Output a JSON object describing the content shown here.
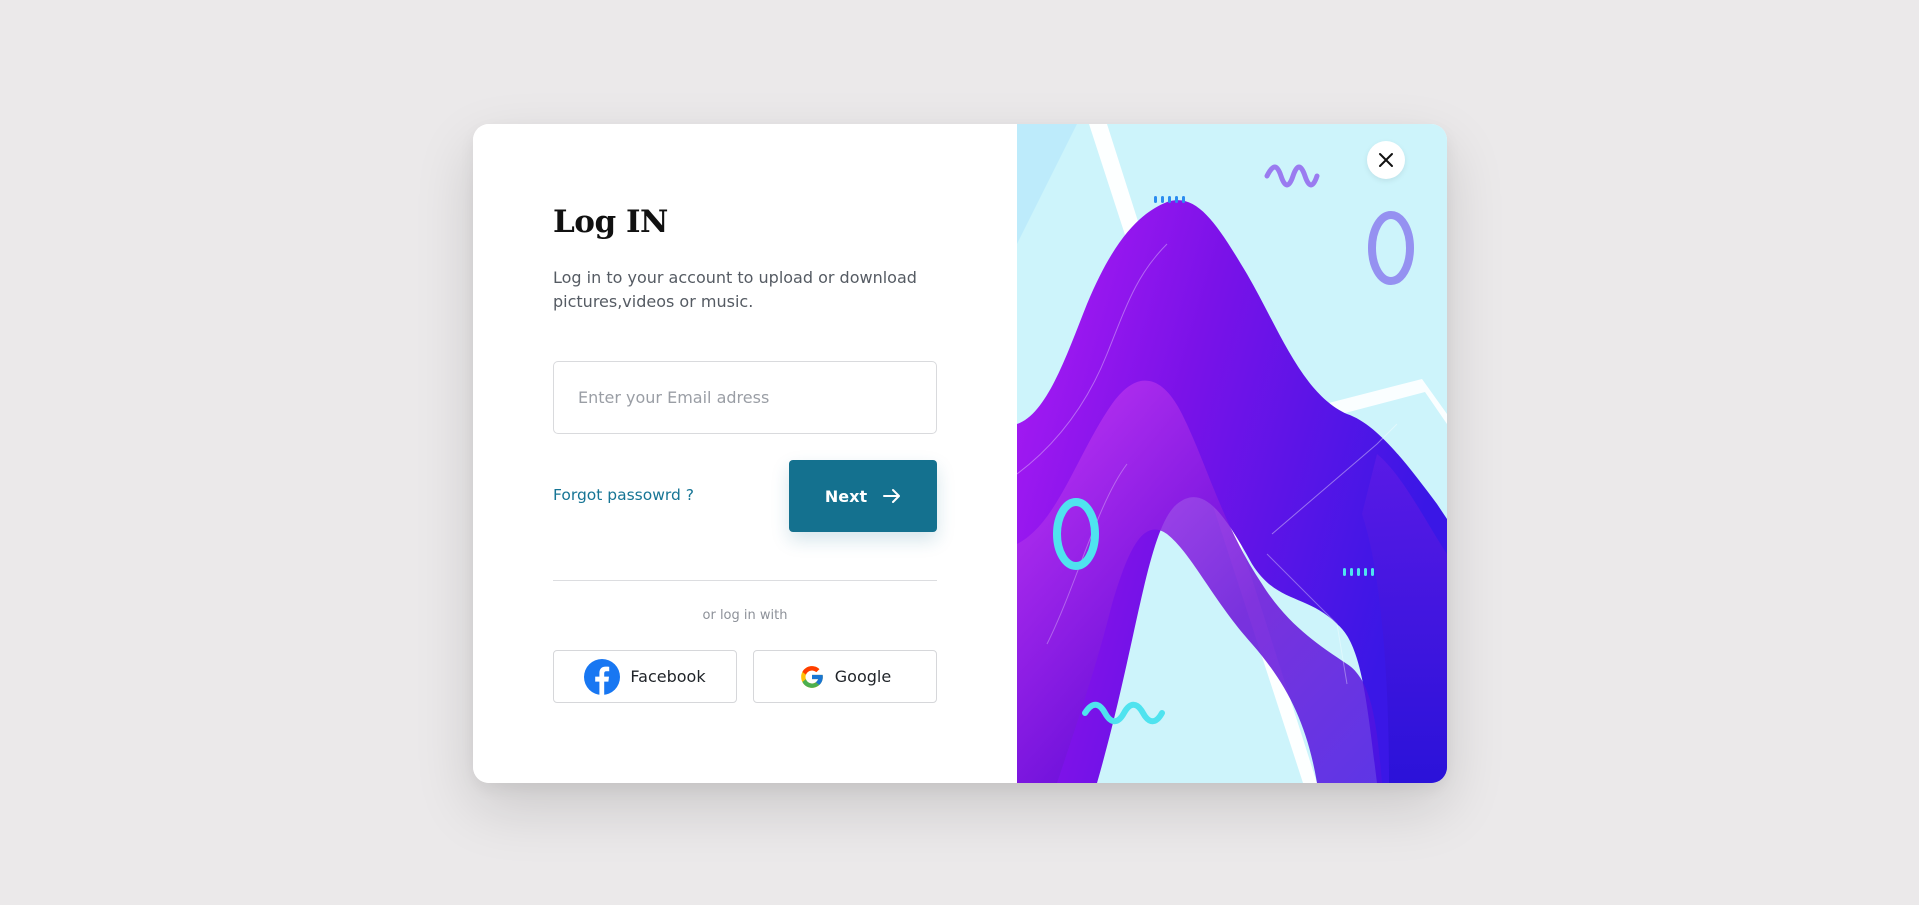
{
  "login": {
    "title": "Log IN",
    "subtitle": "Log in to your account to upload or download pictures,videos or music.",
    "email": {
      "value": "",
      "placeholder": "Enter your Email adress"
    },
    "forgot_label": "Forgot passowrd ?",
    "next_label": "Next",
    "divider_text": "or log in with",
    "social": {
      "facebook_label": "Facebook",
      "google_label": "Google"
    }
  },
  "icons": {
    "next": "arrow-right-icon",
    "facebook": "facebook-icon",
    "google": "google-icon",
    "close": "close-icon"
  },
  "colors": {
    "accent": "#14718f",
    "link": "#167595",
    "page_background": "#ebe9ea",
    "art_background": "#cdf4fb",
    "art_purple": "#8a10f0",
    "art_cyan": "#4fe3ef",
    "facebook_blue": "#1877f2"
  }
}
